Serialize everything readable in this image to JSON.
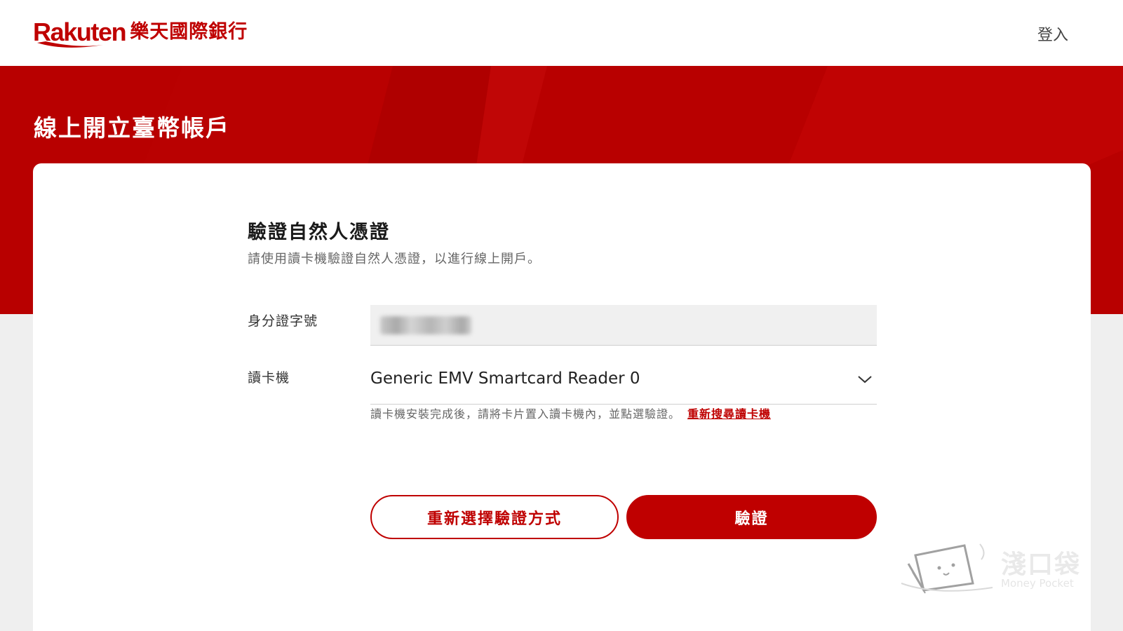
{
  "header": {
    "logo_word": "Rakuten",
    "logo_cn": "樂天國際銀行",
    "login_label": "登入"
  },
  "hero": {
    "title": "線上開立臺幣帳戶"
  },
  "form": {
    "title": "驗證自然人憑證",
    "description": "請使用讀卡機驗證自然人憑證，以進行線上開戶。",
    "id_label": "身分證字號",
    "reader_label": "讀卡機",
    "reader_value": "Generic EMV Smartcard Reader 0",
    "hint": "讀卡機安裝完成後，請將卡片置入讀卡機內，並點選驗證。",
    "rescan_link": "重新搜尋讀卡機",
    "reselect_button": "重新選擇驗證方式",
    "verify_button": "驗證"
  },
  "watermark": {
    "cn": "淺口袋",
    "en": "Money Pocket"
  },
  "colors": {
    "brand_red": "#bf0000",
    "hero_red": "#b80000",
    "page_bg": "#efefef"
  },
  "icons": {
    "dropdown": "chevron-down-icon"
  }
}
